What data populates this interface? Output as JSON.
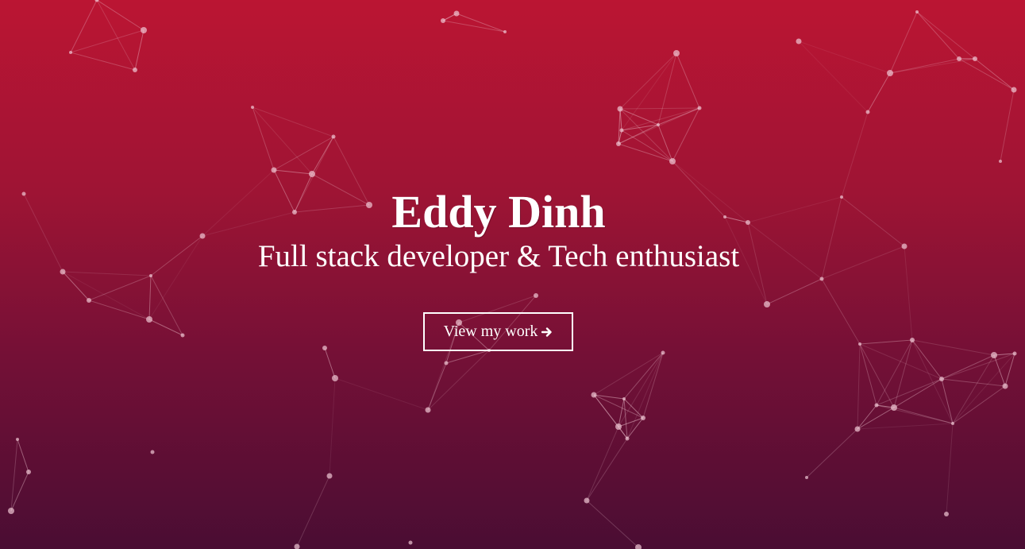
{
  "hero": {
    "name": "Eddy Dinh",
    "tagline": "Full stack developer & Tech enthusiast",
    "cta": {
      "label": "View my work",
      "icon": "arrow-right-icon"
    }
  },
  "background": {
    "effect": "particle-network",
    "gradient_top": "#bb1533",
    "gradient_bottom": "#4a0d33",
    "particle_color": "#f0c8d4"
  },
  "colors": {
    "text": "#ffffff",
    "button_border": "#ffffff"
  }
}
